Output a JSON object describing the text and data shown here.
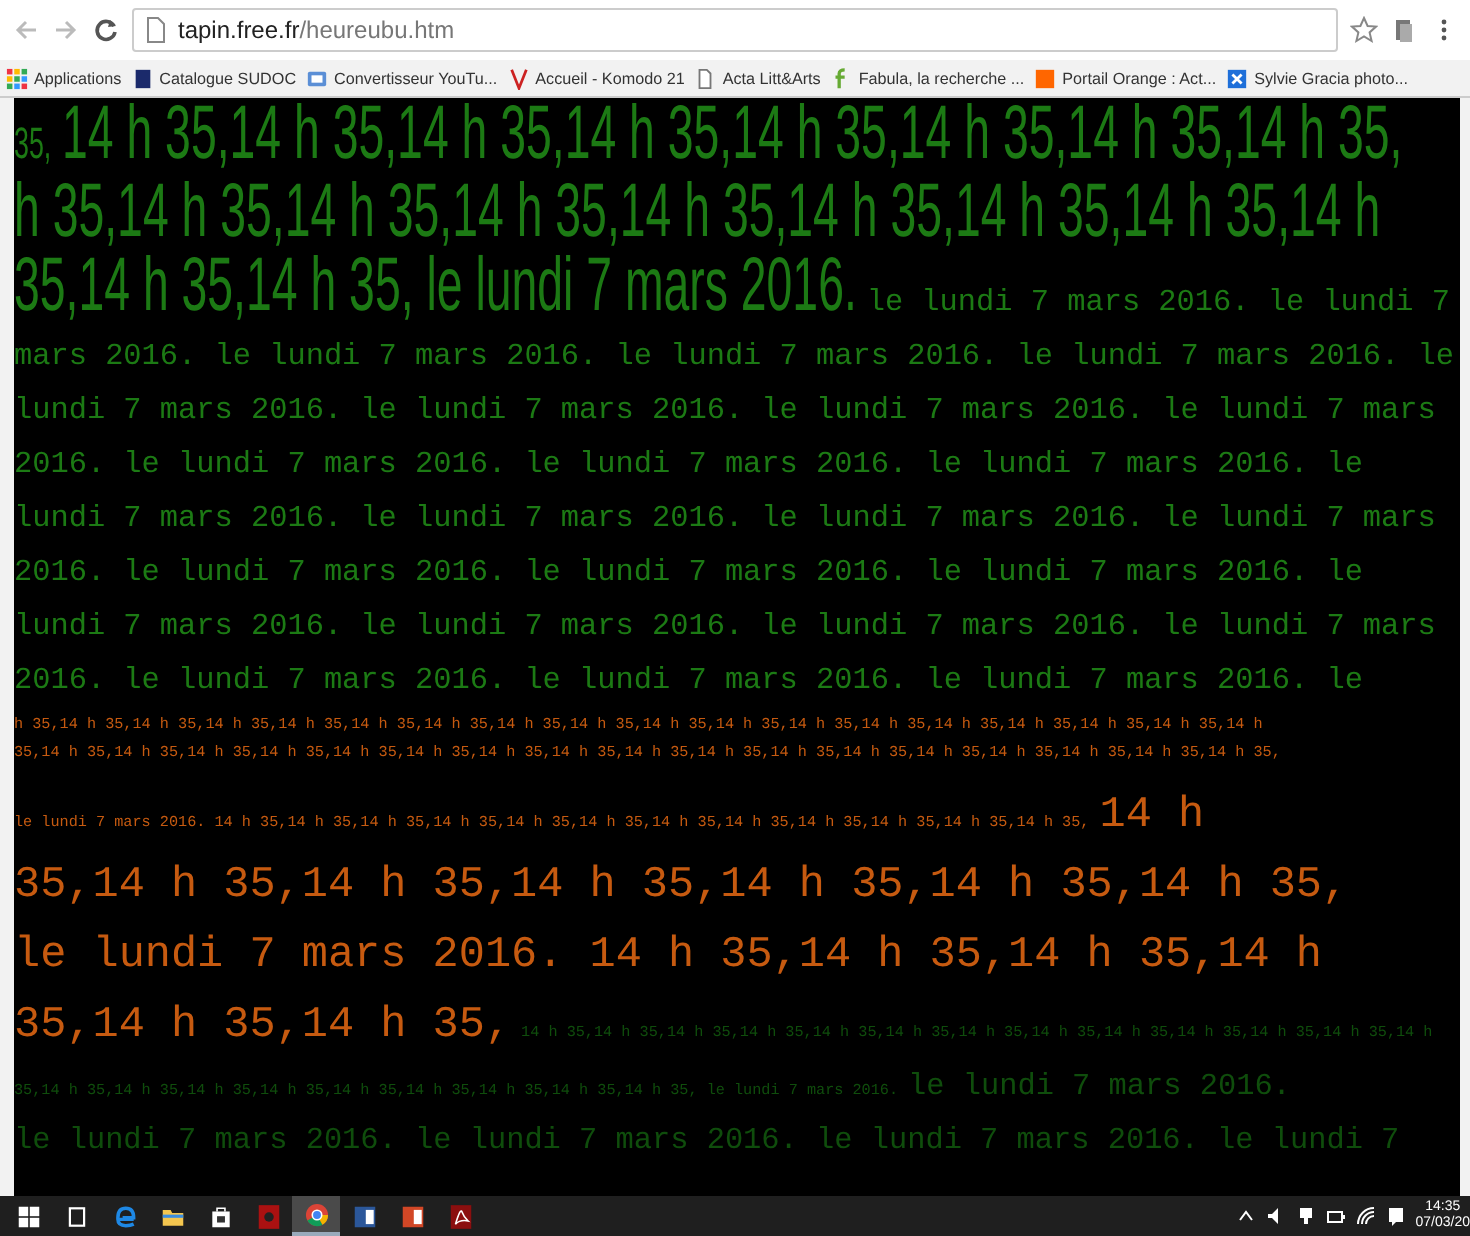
{
  "browser": {
    "url_host": "tapin.free.fr",
    "url_path": "/heureubu.htm",
    "bookmarks": [
      {
        "kind": "apps",
        "label": "Applications"
      },
      {
        "kind": "book",
        "label": "Catalogue SUDOC"
      },
      {
        "kind": "converter",
        "label": "Convertisseur YouTu..."
      },
      {
        "kind": "v",
        "label": "Accueil - Komodo 21"
      },
      {
        "kind": "page",
        "label": "Acta Litt&Arts"
      },
      {
        "kind": "f",
        "label": "Fabula, la recherche ..."
      },
      {
        "kind": "orange",
        "label": "Portail Orange : Act..."
      },
      {
        "kind": "x",
        "label": "Sylvie Gracia photo..."
      }
    ]
  },
  "page": {
    "lines": [
      {
        "segments": [
          {
            "kind": "small",
            "color": "#1c7a14",
            "text": "35,"
          },
          {
            "kind": "headline",
            "color": "#1c7a14",
            "text": "14 h 35,14 h 35,14 h 35,14 h 35,14 h 35,14 h 35,14 h 35,14 h 35,"
          }
        ]
      },
      {
        "segments": [
          {
            "kind": "headline",
            "color": "#1c7a14",
            "text": "h 35,14 h 35,14 h 35,14 h 35,14 h 35,14 h 35,14 h 35,14 h 35,14 h"
          }
        ]
      },
      {
        "segments": [
          {
            "kind": "headline",
            "color": "#1c7a14",
            "text": "35,14 h 35,14 h 35, le lundi 7 mars 2016."
          },
          {
            "kind": "text",
            "color": "#1c7a14",
            "text": "le lundi 7 mars 2016. le lundi 7"
          }
        ]
      },
      {
        "segments": [
          {
            "kind": "text",
            "color": "#1c7a14",
            "text": "mars 2016. le lundi 7 mars 2016. le lundi 7 mars 2016. le lundi 7 mars 2016. le"
          }
        ]
      },
      {
        "segments": [
          {
            "kind": "text",
            "color": "#1c7a14",
            "text": "lundi 7 mars 2016. le lundi 7 mars 2016. le lundi 7 mars 2016. le lundi 7 mars"
          }
        ]
      },
      {
        "segments": [
          {
            "kind": "text",
            "color": "#1c7a14",
            "text": "2016. le lundi 7 mars 2016. le lundi 7 mars 2016. le lundi 7 mars 2016. le"
          }
        ]
      },
      {
        "segments": [
          {
            "kind": "text",
            "color": "#1c7a14",
            "text": "lundi 7 mars 2016. le lundi 7 mars 2016. le lundi 7 mars 2016. le lundi 7 mars"
          }
        ]
      },
      {
        "segments": [
          {
            "kind": "text",
            "color": "#1c7a14",
            "text": "2016. le lundi 7 mars 2016. le lundi 7 mars 2016. le lundi 7 mars 2016. le"
          }
        ]
      },
      {
        "segments": [
          {
            "kind": "text",
            "color": "#1c7a14",
            "text": "lundi 7 mars 2016. le lundi 7 mars 2016. le lundi 7 mars 2016. le lundi 7 mars"
          }
        ]
      },
      {
        "segments": [
          {
            "kind": "text",
            "color": "#1c7a14",
            "text": "2016. le lundi 7 mars 2016. le lundi 7 mars 2016. le lundi 7 mars 2016. le"
          }
        ]
      },
      {
        "segments": [
          {
            "kind": "tiny",
            "color": "#c65a10",
            "text": "h 35,14 h 35,14 h 35,14 h 35,14 h 35,14 h 35,14 h 35,14 h 35,14 h 35,14 h 35,14 h 35,14 h 35,14 h 35,14 h 35,14 h 35,14 h 35,14 h 35,14 h"
          }
        ]
      },
      {
        "segments": [
          {
            "kind": "tiny",
            "color": "#c65a10",
            "text": "35,14 h 35,14 h 35,14 h 35,14 h 35,14 h 35,14 h 35,14 h 35,14 h 35,14 h 35,14 h 35,14 h 35,14 h 35,14 h 35,14 h 35,14 h 35,14 h 35,14 h 35,"
          }
        ]
      },
      {
        "segments": [
          {
            "kind": "tiny",
            "color": "#c65a10",
            "text": "le lundi 7 mars 2016. 14 h 35,14 h 35,14 h 35,14 h 35,14 h 35,14 h 35,14 h 35,14 h 35,14 h 35,14 h 35,14 h 35,14 h 35,"
          },
          {
            "kind": "large",
            "color": "#c65a10",
            "text": "14 h"
          }
        ]
      },
      {
        "segments": [
          {
            "kind": "large",
            "color": "#c65a10",
            "text": "35,14 h 35,14 h 35,14 h 35,14 h 35,14 h 35,14 h 35,"
          }
        ]
      },
      {
        "segments": [
          {
            "kind": "large",
            "color": "#c65a10",
            "text": "le lundi 7 mars 2016. 14 h 35,14 h 35,14 h 35,14 h"
          }
        ]
      },
      {
        "segments": [
          {
            "kind": "large",
            "color": "#c65a10",
            "text": "35,14 h 35,14 h 35,"
          },
          {
            "kind": "tiny",
            "color": "#0f4d0c",
            "text": "14 h 35,14 h 35,14 h 35,14 h 35,14 h 35,14 h 35,14 h 35,14 h 35,14 h 35,14 h 35,14 h 35,14 h 35,14 h"
          }
        ]
      },
      {
        "segments": [
          {
            "kind": "tiny",
            "color": "#0f4d0c",
            "text": "35,14 h 35,14 h 35,14 h 35,14 h 35,14 h 35,14 h 35,14 h 35,14 h 35,14 h 35, le lundi 7 mars 2016."
          },
          {
            "kind": "text",
            "color": "#0f4d0c",
            "text": "le lundi 7 mars 2016."
          }
        ]
      },
      {
        "segments": [
          {
            "kind": "text",
            "color": "#0f4d0c",
            "text": "le lundi 7 mars 2016. le lundi 7 mars 2016. le lundi 7 mars 2016. le lundi 7"
          }
        ]
      }
    ]
  },
  "taskbar": {
    "apps": [
      {
        "kind": "start",
        "selected": false
      },
      {
        "kind": "taskview",
        "selected": false
      },
      {
        "kind": "edge",
        "selected": false
      },
      {
        "kind": "folder",
        "selected": false
      },
      {
        "kind": "store",
        "selected": false
      },
      {
        "kind": "red-app",
        "selected": false
      },
      {
        "kind": "chrome",
        "selected": true
      },
      {
        "kind": "word",
        "selected": false
      },
      {
        "kind": "powerpoint",
        "selected": false
      },
      {
        "kind": "acrobat",
        "selected": false
      }
    ],
    "time": "14:35",
    "date": "07/03/20"
  }
}
